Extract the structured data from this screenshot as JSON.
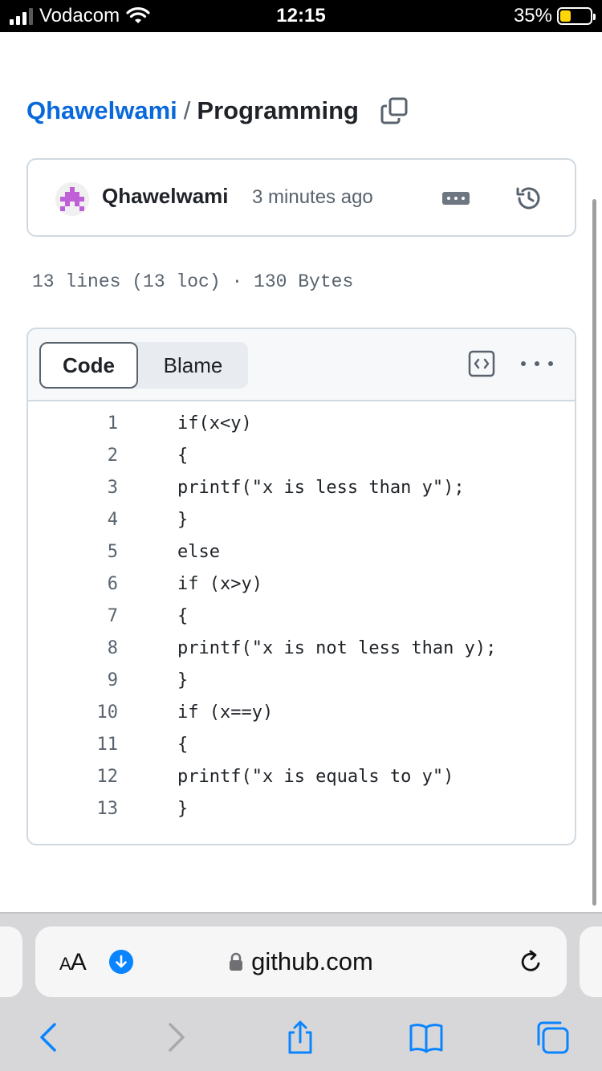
{
  "status_bar": {
    "carrier": "Vodacom",
    "time": "12:15",
    "battery_percent": "35%",
    "battery_level": 0.35,
    "icons": [
      "signal-icon",
      "wifi-icon",
      "battery-icon"
    ]
  },
  "breadcrumb": {
    "owner": "Qhawelwami",
    "separator": "/",
    "file": "Programming",
    "copy_icon": "copy-icon"
  },
  "commit": {
    "author": "Qhawelwami",
    "time_ago": "3 minutes ago",
    "icons": [
      "avatar",
      "ellipsis-icon",
      "history-icon"
    ]
  },
  "file_info": "13 lines (13 loc) · 130 Bytes",
  "code_view": {
    "tabs": [
      {
        "label": "Code",
        "selected": true
      },
      {
        "label": "Blame",
        "selected": false
      }
    ],
    "icons": [
      "symbols-icon",
      "more-options-icon"
    ],
    "lines": [
      {
        "num": "1",
        "text": "if(x<y)"
      },
      {
        "num": "2",
        "text": "{"
      },
      {
        "num": "3",
        "text": "printf(\"x is less than y\");"
      },
      {
        "num": "4",
        "text": "}"
      },
      {
        "num": "5",
        "text": "else"
      },
      {
        "num": "6",
        "text": "if (x>y)"
      },
      {
        "num": "7",
        "text": "{"
      },
      {
        "num": "8",
        "text": "printf(\"x is not less than y);"
      },
      {
        "num": "9",
        "text": "}"
      },
      {
        "num": "10",
        "text": "if (x==y)"
      },
      {
        "num": "11",
        "text": "{"
      },
      {
        "num": "12",
        "text": "printf(\"x is equals to y\")"
      },
      {
        "num": "13",
        "text": "}"
      }
    ]
  },
  "safari": {
    "text_size_label_large": "A",
    "text_size_label_small": "A",
    "url": "github.com",
    "accent": "#0a84ff",
    "icons": [
      "download-icon",
      "lock-icon",
      "reload-icon",
      "back-icon",
      "forward-icon",
      "share-icon",
      "bookmarks-icon",
      "tabs-icon"
    ]
  }
}
